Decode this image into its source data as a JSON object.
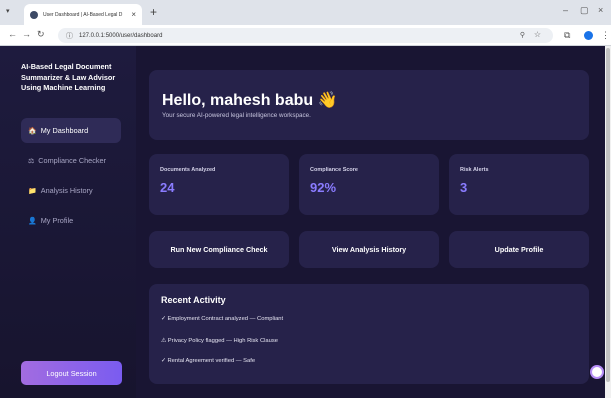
{
  "browser": {
    "tab_title": "User Dashboard | AI-Based Legal D",
    "tab_close": "×",
    "new_tab": "+",
    "url": "127.0.0.1:5000/user/dashboard",
    "win_min": "–",
    "win_max": "▢",
    "win_close": "×"
  },
  "sidebar": {
    "brand": "AI-Based Legal Document Summarizer & Law Advisor Using Machine Learning",
    "items": [
      {
        "icon": "🏠",
        "label": "My Dashboard"
      },
      {
        "icon": "⚖",
        "label": "Compliance Checker"
      },
      {
        "icon": "📁",
        "label": "Analysis History"
      },
      {
        "icon": "👤",
        "label": "My Profile"
      }
    ],
    "logout_label": "Logout Session"
  },
  "hero": {
    "greeting": "Hello, mahesh babu 👋",
    "subtitle": "Your secure AI-powered legal intelligence workspace."
  },
  "stats": [
    {
      "label": "Documents Analyzed",
      "value": "24"
    },
    {
      "label": "Compliance Score",
      "value": "92%"
    },
    {
      "label": "Risk Alerts",
      "value": "3"
    }
  ],
  "actions": [
    {
      "label": "Run New Compliance Check"
    },
    {
      "label": "View Analysis History"
    },
    {
      "label": "Update Profile"
    }
  ],
  "recent": {
    "title": "Recent Activity",
    "items": [
      "✓ Employment Contract analyzed — Compliant",
      "⚠ Privacy Policy flagged — High Risk Clause",
      "✓ Rental Agreement verified — Safe"
    ]
  },
  "colors": {
    "accent": "#8a7cff",
    "background": "#191533",
    "card": "#26224a",
    "logout_gradient_start": "#a26ce0",
    "logout_gradient_end": "#7a5cf0"
  }
}
